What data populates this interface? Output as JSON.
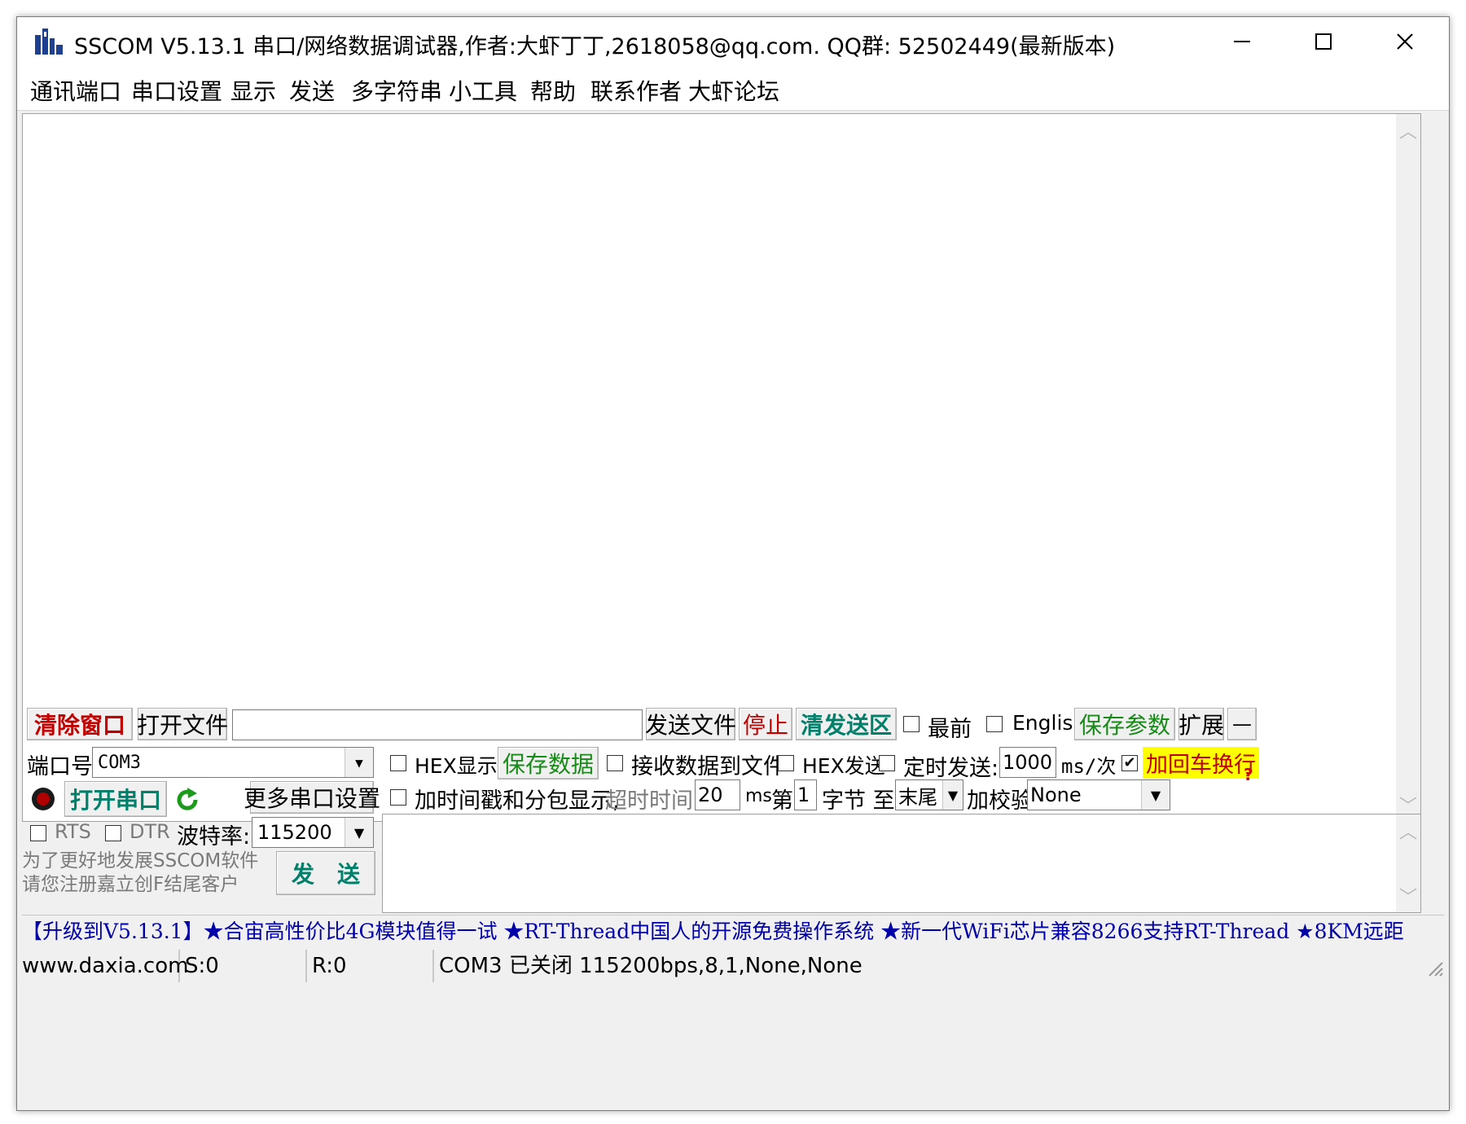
{
  "window": {
    "title": "SSCOM V5.13.1 串口/网络数据调试器,作者:大虾丁丁,2618058@qq.com. QQ群: 52502449(最新版本)",
    "minimize_icon": "minimize-icon",
    "maximize_icon": "maximize-icon",
    "close_icon": "close-icon"
  },
  "menu": {
    "items": [
      "通讯端口",
      "串口设置",
      "显示",
      "发送",
      "多字符串",
      "小工具",
      "帮助",
      "联系作者",
      "大虾论坛"
    ]
  },
  "toolbar": {
    "clear_window": "清除窗口",
    "open_file": "打开文件",
    "file_path_value": "",
    "send_file": "发送文件",
    "stop": "停止",
    "clear_send": "清发送区",
    "topmost_label": "最前",
    "topmost_checked": false,
    "english_label": "English",
    "english_checked": false,
    "save_params": "保存参数",
    "expand": "扩展",
    "collapse": "—"
  },
  "port": {
    "port_label": "端口号",
    "port_value": "COM3",
    "open_port": "打开串口",
    "more_settings": "更多串口设置",
    "rts_label": "RTS",
    "rts_checked": false,
    "dtr_label": "DTR",
    "dtr_checked": false,
    "baud_label": "波特率:",
    "baud_value": "115200",
    "promo_line1": "为了更好地发展SSCOM软件",
    "promo_line2": "请您注册嘉立创F结尾客户",
    "send_button": "发　送"
  },
  "options": {
    "hex_display_label": "HEX显示",
    "hex_display_checked": false,
    "save_data": "保存数据",
    "recv_to_file_label": "接收数据到文件",
    "recv_to_file_checked": false,
    "hex_send_label": "HEX发送",
    "hex_send_checked": false,
    "timed_send_label": "定时发送:",
    "timed_send_checked": false,
    "interval_value": "1000",
    "interval_unit": "ms/次",
    "add_crlf_label": "加回车换行",
    "add_crlf_checked": true,
    "timestamp_label": "加时间戳和分包显示,",
    "timestamp_checked": false,
    "timeout_label": "超时时间:",
    "timeout_value": "20",
    "timeout_unit": "ms",
    "byte_prefix": "第",
    "byte_value": "1",
    "byte_suffix": "字节 至",
    "end_value": "末尾",
    "checksum_label": "加校验",
    "checksum_value": "None"
  },
  "banner": {
    "text": "【升级到V5.13.1】★合宙高性价比4G模块值得一试 ★RT-Thread中国人的开源免费操作系统 ★新一代WiFi芯片兼容8266支持RT-Thread ★8KM远距"
  },
  "status": {
    "website": "www.daxia.com",
    "sent": "S:0",
    "received": "R:0",
    "port_state": "COM3 已关闭  115200bps,8,1,None,None"
  }
}
